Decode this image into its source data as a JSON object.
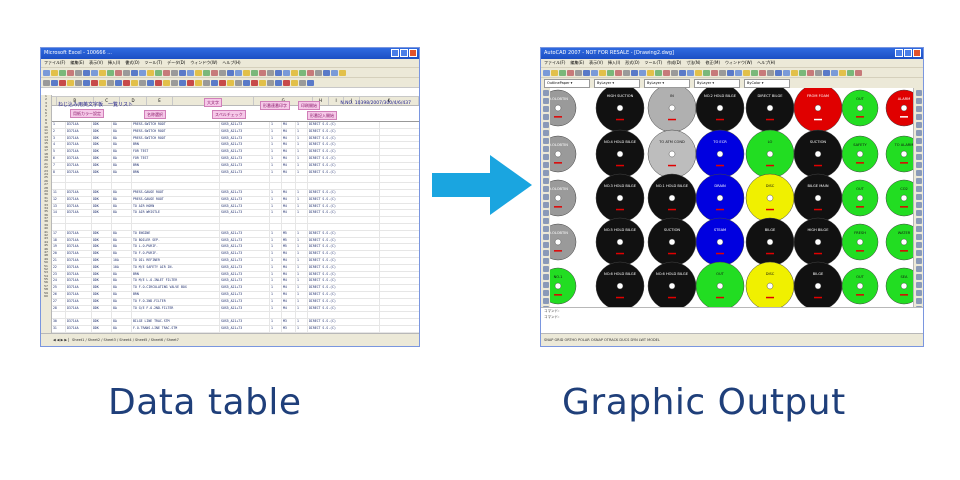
{
  "left_window": {
    "title": "Microsoft Excel - 100666 ...",
    "menu": [
      "ファイル(F)",
      "編集(E)",
      "表示(V)",
      "挿入(I)",
      "書式(O)",
      "ツール(T)",
      "データ(D)",
      "ウィンドウ(W)",
      "ヘルプ(H)"
    ],
    "columns": [
      "A",
      "B",
      "C",
      "D",
      "E",
      "F",
      "G",
      "H",
      "I",
      "J",
      "K"
    ],
    "doc_title": "ねじ込み用英文字板　一覧リスト",
    "doc_number": "N.NO. 10398/2007/300/4/6/437",
    "buttons": [
      "用紙カラー設定",
      "名称選択",
      "大文字",
      "スペルチェック",
      "形番連番印字",
      "印刷開始",
      "形番記入開始"
    ],
    "rows": [
      [
        "1",
        "D3714A",
        "DDK",
        "8A",
        "PRESS.SWITCH ROOT",
        "SUS5_A21+73",
        "1",
        "M4",
        "1"
      ],
      [
        "2",
        "D3714A",
        "DDK",
        "8A",
        "PRESS.SWITCH ROOT",
        "SUS5_A21+73",
        "1",
        "M4",
        "1"
      ],
      [
        "3",
        "D3714A",
        "DDK",
        "8A",
        "PRESS.SWITCH ROOT",
        "SUS5_A21+73",
        "1",
        "M4",
        "1"
      ],
      [
        "4",
        "D3714A",
        "DDK",
        "8A",
        "BRN",
        "SUS5_A21+73",
        "1",
        "M4",
        "1"
      ],
      [
        "5",
        "D3714A",
        "DDK",
        "8A",
        "FOR TEST",
        "SUS5_A21+73",
        "1",
        "M4",
        "1"
      ],
      [
        "6",
        "D3714A",
        "DDK",
        "8A",
        "FOR TEST",
        "SUS5_A21+73",
        "1",
        "M4",
        "1"
      ],
      [
        "7",
        "D3714A",
        "DDK",
        "8A",
        "BRN",
        "SUS5_A21+73",
        "1",
        "M4",
        "1"
      ],
      [
        "8",
        "D3714A",
        "DDK",
        "8A",
        "BRN",
        "SUS5_A21+73",
        "1",
        "M4",
        "1"
      ],
      [
        "9",
        "",
        "",
        "",
        "",
        "",
        "",
        "",
        ""
      ],
      [
        "10",
        "",
        "",
        "",
        "",
        "",
        "",
        "",
        ""
      ],
      [
        "11",
        "D3714A",
        "DDK",
        "8A",
        "PRESS.GAUGE ROOT",
        "SUS5_A21+73",
        "1",
        "M4",
        "1"
      ],
      [
        "12",
        "D3714A",
        "DDK",
        "8A",
        "PRESS.GAUGE ROOT",
        "SUS5_A21+73",
        "1",
        "M4",
        "1"
      ],
      [
        "13",
        "D3714A",
        "DDK",
        "8A",
        "TO AIR HORN",
        "SUS5_A21+73",
        "1",
        "M4",
        "1"
      ],
      [
        "14",
        "D3714A",
        "DDK",
        "8A",
        "TO AIR WHISTLE",
        "SUS5_A21+73",
        "1",
        "M4",
        "1"
      ],
      [
        "15",
        "",
        "",
        "",
        "",
        "",
        "",
        "",
        ""
      ],
      [
        "16",
        "",
        "",
        "",
        "",
        "",
        "",
        "",
        ""
      ],
      [
        "17",
        "D3714A",
        "DDK",
        "8A",
        "TO ENGINE",
        "SUS5_A21+73",
        "1",
        "M5",
        "1"
      ],
      [
        "18",
        "D3714A",
        "DDK",
        "8A",
        "TO BOILER SEP.",
        "SUS5_A21+73",
        "1",
        "M5",
        "1"
      ],
      [
        "19",
        "D3714A",
        "DDK",
        "8A",
        "TO L.O.PURIF.",
        "SUS5_A21+73",
        "1",
        "M5",
        "1"
      ],
      [
        "20",
        "D3714A",
        "DDK",
        "8A",
        "TO F.O.PURIF.",
        "SUS5_A21+73",
        "1",
        "M4",
        "1"
      ],
      [
        "21",
        "D3714A",
        "DDK",
        "10A",
        "TO OIL REFINER",
        "SUS5_A21+73",
        "1",
        "M4",
        "1"
      ],
      [
        "22",
        "D3714A",
        "DDK",
        "10A",
        "TO M/E SAFETY AIR IN.",
        "SUS5_A21+73",
        "1",
        "M4",
        "1"
      ],
      [
        "23",
        "D3714A",
        "DDK",
        "8A",
        "BRN",
        "SUS5_A21+73",
        "1",
        "M4",
        "1"
      ],
      [
        "24",
        "D3714A",
        "DDK",
        "8A",
        "TO M/E L.O.INLET FILTER",
        "SUS5_A21+73",
        "1",
        "M4",
        "1"
      ],
      [
        "25",
        "D3714A",
        "DDK",
        "8A",
        "TO F.O.CIRCULATING VALVE BOX",
        "SUS5_A21+73",
        "1",
        "M4",
        "1"
      ],
      [
        "26",
        "D3714A",
        "DDK",
        "8A",
        "BRN",
        "SUS5_A21+73",
        "1",
        "M4",
        "1"
      ],
      [
        "27",
        "D3714A",
        "DDK",
        "8A",
        "TO F.O.2ND.FILTER",
        "SUS5_A21+73",
        "1",
        "M4",
        "1"
      ],
      [
        "28",
        "D3714A",
        "DDK",
        "8A",
        "TO G/E F.O.2ND.FILTER",
        "SUS5_A21+73",
        "1",
        "M4",
        "1"
      ],
      [
        "29",
        "",
        "",
        "",
        "",
        "",
        "",
        "",
        ""
      ],
      [
        "30",
        "D3714A",
        "DDK",
        "8A",
        "BILGE LINE TRAC.STM",
        "SUS5_A21+73",
        "1",
        "M3",
        "1"
      ],
      [
        "31",
        "D3714A",
        "DDK",
        "8A",
        "F.O.TRANS.LINE TRAC.STM",
        "SUS5_A21+73",
        "1",
        "M3",
        "1"
      ],
      [
        "32",
        "D3714A",
        "DDK",
        "8A",
        "F.O.TRANS.LINE TRAC.STM",
        "SUS5_A21+73",
        "1",
        "M3",
        "1"
      ],
      [
        "33",
        "D3714A",
        "DDK",
        "8A",
        "BRN",
        "SUS5_A21+73",
        "1",
        "M3",
        "1"
      ],
      [
        "34",
        "D3714A",
        "DDK",
        "8A",
        "BRN",
        "SUS5_A21+73",
        "1",
        "M3",
        "1"
      ],
      [
        "35",
        "D3714A",
        "DDK",
        "8A",
        "PRESS.IND.CONT.VENT",
        "SUS5_A21+73",
        "1",
        "M3",
        "1"
      ]
    ]
  },
  "right_window": {
    "title": "AutoCAD 2007 - NOT FOR RESALE - [Drawing2.dwg]",
    "menu": [
      "ファイル(F)",
      "編集(E)",
      "表示(V)",
      "挿入(I)",
      "形式(O)",
      "ツール(T)",
      "作成(D)",
      "寸法(N)",
      "修正(M)",
      "ウィンドウ(W)",
      "ヘルプ(H)"
    ],
    "layer_boxes": [
      "OutlinePaper",
      "ByLayer",
      "ByLayer",
      "ByLayer",
      "ByColor"
    ],
    "command_lines": [
      "コマンド：",
      "コマンド："
    ],
    "discs": [
      {
        "color": "#9a9a9a",
        "text": "D.OLOBTIN"
      },
      {
        "color": "#111111",
        "text": "HIGH SUCTION"
      },
      {
        "color": "#b0b0b0",
        "text": "IN"
      },
      {
        "color": "#111111",
        "text": "NO.2 HOLD BILGE"
      },
      {
        "color": "#111111",
        "text": "DIRECT BILGE"
      },
      {
        "color": "#e00000",
        "text": "FROM FOAM"
      },
      {
        "color": "#22dd22",
        "text": "OUT"
      },
      {
        "color": "#e00000",
        "text": "ALARM"
      },
      {
        "color": "#9a9a9a",
        "text": "D.OLOBTIN"
      },
      {
        "color": "#111111",
        "text": "NO.4 HOLD BILGE"
      },
      {
        "color": "#bdbdbd",
        "text": "TO ATM COND"
      },
      {
        "color": "#0000e0",
        "text": "TO ECR"
      },
      {
        "color": "#22dd22",
        "text": "LO"
      },
      {
        "color": "#111111",
        "text": "SUCTION"
      },
      {
        "color": "#22dd22",
        "text": "SAFETY"
      },
      {
        "color": "#22dd22",
        "text": "TO ALARM"
      },
      {
        "color": "#9a9a9a",
        "text": "D.OLOBTIN"
      },
      {
        "color": "#111111",
        "text": "NO.3 HOLD BILGE"
      },
      {
        "color": "#111111",
        "text": "NO.1 HOLD BILGE"
      },
      {
        "color": "#0000e0",
        "text": "DRAIN"
      },
      {
        "color": "#f0f000",
        "text": "DISC"
      },
      {
        "color": "#111111",
        "text": "BILGE MAIN"
      },
      {
        "color": "#22dd22",
        "text": "OUT"
      },
      {
        "color": "#22dd22",
        "text": "CO2"
      },
      {
        "color": "#9a9a9a",
        "text": "D.OLOBTIN"
      },
      {
        "color": "#111111",
        "text": "NO.5 HOLD BILGE"
      },
      {
        "color": "#111111",
        "text": "SUCTION"
      },
      {
        "color": "#0000e0",
        "text": "STEAM"
      },
      {
        "color": "#111111",
        "text": "BILGE"
      },
      {
        "color": "#111111",
        "text": "HIGH BILGE"
      },
      {
        "color": "#22dd22",
        "text": "FRESH"
      },
      {
        "color": "#22dd22",
        "text": "WATER"
      },
      {
        "color": "#22dd22",
        "text": "NO.1"
      },
      {
        "color": "#111111",
        "text": "NO.6 HOLD BILGE"
      },
      {
        "color": "#111111",
        "text": "NO.6 HOLD BILGE"
      },
      {
        "color": "#22dd22",
        "text": "OUT"
      },
      {
        "color": "#f0f000",
        "text": "DISC"
      },
      {
        "color": "#111111",
        "text": "BILGE"
      },
      {
        "color": "#22dd22",
        "text": "OUT"
      },
      {
        "color": "#22dd22",
        "text": "SEA"
      }
    ]
  },
  "captions": {
    "left": "Data table",
    "right": "Graphic Output"
  },
  "colors": {
    "arrow": "#1aa5e0",
    "caption": "#1f3f7a"
  }
}
